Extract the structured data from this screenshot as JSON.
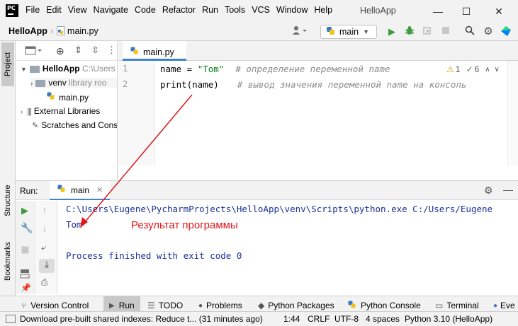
{
  "window": {
    "logo_text": "PC",
    "title": "HelloApp",
    "menu": [
      "File",
      "Edit",
      "View",
      "Navigate",
      "Code",
      "Refactor",
      "Run",
      "Tools",
      "VCS",
      "Window",
      "Help"
    ],
    "controls": {
      "minimize": "—",
      "maximize": "☐",
      "close": "✕"
    }
  },
  "navbar": {
    "project": "HelloApp",
    "file": "main.py",
    "run_config": "main"
  },
  "left_strip": {
    "project_tab": "Project",
    "structure_tab": "Structure",
    "bookmarks_tab": "Bookmarks"
  },
  "project_tree": {
    "root_name": "HelloApp",
    "root_path": "C:\\Users",
    "venv_name": "venv",
    "venv_note": "library roo",
    "main_file": "main.py",
    "external": "External Libraries",
    "scratches": "Scratches and Cons"
  },
  "editor": {
    "tab_label": "main.py",
    "line_numbers": [
      "1",
      "2"
    ],
    "line1_code": "name = ",
    "line1_string": "\"Tom\"",
    "line1_comment": "# определение переменной name",
    "line2_code": "print(name)",
    "line2_comment": "# вывод значения переменной name на консоль",
    "inspection_warnings": "1",
    "inspection_checks": "6"
  },
  "run_panel": {
    "label": "Run:",
    "config": "main",
    "console_lines": [
      "C:\\Users\\Eugene\\PycharmProjects\\HelloApp\\venv\\Scripts\\python.exe C:/Users/Eugene",
      "Tom",
      "",
      "Process finished with exit code 0"
    ],
    "annotation": "Результат программы"
  },
  "bottom_tabs": [
    "Version Control",
    "Run",
    "TODO",
    "Problems",
    "Python Packages",
    "Python Console",
    "Terminal",
    "Eve"
  ],
  "status_bar": {
    "message": "Download pre-built shared indexes: Reduce t... (31 minutes ago)",
    "position": "1:44",
    "line_sep": "CRLF",
    "encoding": "UTF-8",
    "indent": "4 spaces",
    "interpreter": "Python 3.10 (HelloApp)"
  },
  "colors": {
    "annotation": "#e0161a",
    "console_text": "#1a2f9a",
    "run_green": "#3d9a3d",
    "tab_underline": "#4083c9"
  }
}
